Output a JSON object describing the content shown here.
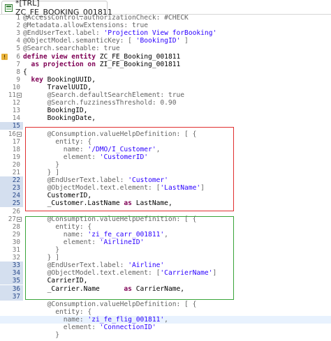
{
  "tab": {
    "title": "*[TRL] ZC_FE_BOOKING_001811",
    "icon": "cds-view-icon"
  },
  "editor": {
    "current_line": 46,
    "lines": [
      {
        "n": "1",
        "tokens": [
          {
            "t": "@AccessControl.authorizationCheck: #CHECK",
            "c": "ann"
          }
        ]
      },
      {
        "n": "2",
        "tokens": [
          {
            "t": "@Metadata.allowExtensions: true",
            "c": "ann"
          }
        ]
      },
      {
        "n": "3",
        "tokens": [
          {
            "t": "@EndUserText.label: ",
            "c": "ann"
          },
          {
            "t": "'Projection View forBooking'",
            "c": "str"
          }
        ]
      },
      {
        "n": "4",
        "tokens": [
          {
            "t": "@ObjectModel.semanticKey: [ ",
            "c": "ann"
          },
          {
            "t": "'BookingID'",
            "c": "str"
          },
          {
            "t": " ]",
            "c": "ann"
          }
        ]
      },
      {
        "n": "5",
        "tokens": [
          {
            "t": "@Search.searchable: true",
            "c": "ann"
          }
        ]
      },
      {
        "n": "6",
        "warn": true,
        "tokens": [
          {
            "t": "define view entity ",
            "c": "kw"
          },
          {
            "t": "ZC_FE_Booking_001811",
            "c": "plain"
          }
        ]
      },
      {
        "n": "7",
        "tokens": [
          {
            "t": "  as projection on ",
            "c": "kw"
          },
          {
            "t": "ZI_FE_Booking_001811",
            "c": "plain"
          }
        ]
      },
      {
        "n": "8",
        "tokens": [
          {
            "t": "{",
            "c": "plain"
          }
        ]
      },
      {
        "n": "9",
        "tokens": [
          {
            "t": "  key ",
            "c": "kw"
          },
          {
            "t": "BookingUUID,",
            "c": "plain"
          }
        ]
      },
      {
        "n": "10",
        "tokens": [
          {
            "t": "      TravelUUID,",
            "c": "plain"
          }
        ]
      },
      {
        "n": "11",
        "fold": true,
        "tokens": [
          {
            "t": "      @Search.defaultSearchElement: true",
            "c": "ann"
          }
        ]
      },
      {
        "n": "12",
        "tokens": [
          {
            "t": "      @Search.fuzzinessThreshold: 0.90",
            "c": "ann"
          }
        ]
      },
      {
        "n": "13",
        "tokens": [
          {
            "t": "      BookingID,",
            "c": "plain"
          }
        ]
      },
      {
        "n": "14",
        "tokens": [
          {
            "t": "      BookingDate,",
            "c": "plain"
          }
        ]
      },
      {
        "n": "15",
        "sel": true,
        "tokens": []
      },
      {
        "n": "16",
        "fold": true,
        "tokens": [
          {
            "t": "      @Consumption.valueHelpDefinition: [ {",
            "c": "ann"
          }
        ]
      },
      {
        "n": "17",
        "tokens": [
          {
            "t": "        entity: {",
            "c": "ann"
          }
        ]
      },
      {
        "n": "18",
        "tokens": [
          {
            "t": "          name: ",
            "c": "ann"
          },
          {
            "t": "'/DMO/I_Customer'",
            "c": "str"
          },
          {
            "t": ",",
            "c": "ann"
          }
        ]
      },
      {
        "n": "19",
        "tokens": [
          {
            "t": "          element: ",
            "c": "ann"
          },
          {
            "t": "'CustomerID'",
            "c": "str"
          }
        ]
      },
      {
        "n": "20",
        "tokens": [
          {
            "t": "        }",
            "c": "ann"
          }
        ]
      },
      {
        "n": "21",
        "tokens": [
          {
            "t": "      } ]",
            "c": "ann"
          }
        ]
      },
      {
        "n": "22",
        "sel": true,
        "tokens": [
          {
            "t": "      @EndUserText.label: ",
            "c": "ann"
          },
          {
            "t": "'Customer'",
            "c": "str"
          }
        ]
      },
      {
        "n": "23",
        "sel": true,
        "tokens": [
          {
            "t": "      @ObjectModel.text.element: [",
            "c": "ann"
          },
          {
            "t": "'LastName'",
            "c": "str"
          },
          {
            "t": "]",
            "c": "ann"
          }
        ]
      },
      {
        "n": "24",
        "sel": true,
        "tokens": [
          {
            "t": "      CustomerID,",
            "c": "plain"
          }
        ]
      },
      {
        "n": "25",
        "sel": true,
        "tokens": [
          {
            "t": "      _Customer.LastName ",
            "c": "plain"
          },
          {
            "t": "as",
            "c": "kw"
          },
          {
            "t": " LastName,",
            "c": "plain"
          }
        ]
      },
      {
        "n": "26",
        "tokens": []
      },
      {
        "n": "27",
        "fold": true,
        "tokens": [
          {
            "t": "      @Consumption.valueHelpDefinition: [ {",
            "c": "ann"
          }
        ]
      },
      {
        "n": "28",
        "tokens": [
          {
            "t": "        entity: {",
            "c": "ann"
          }
        ]
      },
      {
        "n": "29",
        "tokens": [
          {
            "t": "          name: ",
            "c": "ann"
          },
          {
            "t": "'zi_fe_carr_001811'",
            "c": "str"
          },
          {
            "t": ",",
            "c": "ann"
          }
        ]
      },
      {
        "n": "30",
        "tokens": [
          {
            "t": "          element: ",
            "c": "ann"
          },
          {
            "t": "'AirlineID'",
            "c": "str"
          }
        ]
      },
      {
        "n": "31",
        "tokens": [
          {
            "t": "        }",
            "c": "ann"
          }
        ]
      },
      {
        "n": "32",
        "tokens": [
          {
            "t": "      } ]",
            "c": "ann"
          }
        ]
      },
      {
        "n": "33",
        "sel": true,
        "tokens": [
          {
            "t": "      @EndUserText.label: ",
            "c": "ann"
          },
          {
            "t": "'Airline'",
            "c": "str"
          }
        ]
      },
      {
        "n": "34",
        "sel": true,
        "tokens": [
          {
            "t": "      @ObjectModel.text.element: [",
            "c": "ann"
          },
          {
            "t": "'CarrierName'",
            "c": "str"
          },
          {
            "t": "]",
            "c": "ann"
          }
        ]
      },
      {
        "n": "35",
        "sel": true,
        "tokens": [
          {
            "t": "      CarrierID,",
            "c": "plain"
          }
        ]
      },
      {
        "n": "36",
        "sel": true,
        "tokens": [
          {
            "t": "      _Carrier.Name      ",
            "c": "plain"
          },
          {
            "t": "as",
            "c": "kw"
          },
          {
            "t": " CarrierName,",
            "c": "plain"
          }
        ]
      },
      {
        "n": "37",
        "sel": true,
        "tokens": []
      },
      {
        "n": "",
        "tokens": [
          {
            "t": "      @Consumption.valueHelpDefinition: [ {",
            "c": "ann"
          }
        ]
      },
      {
        "n": "",
        "tokens": [
          {
            "t": "        entity: {",
            "c": "ann"
          }
        ]
      },
      {
        "n": "",
        "current": true,
        "tokens": [
          {
            "t": "          name: ",
            "c": "ann"
          },
          {
            "t": "'zi_fe_flig_001811'",
            "c": "str"
          },
          {
            "t": ",",
            "c": "ann"
          }
        ]
      },
      {
        "n": "",
        "tokens": [
          {
            "t": "          element: ",
            "c": "ann"
          },
          {
            "t": "'ConnectionID'",
            "c": "str"
          }
        ]
      },
      {
        "n": "",
        "tokens": [
          {
            "t": "        }",
            "c": "ann"
          }
        ]
      }
    ]
  },
  "highlights": {
    "red_color": "#e03030",
    "green_color": "#3aa53a"
  }
}
